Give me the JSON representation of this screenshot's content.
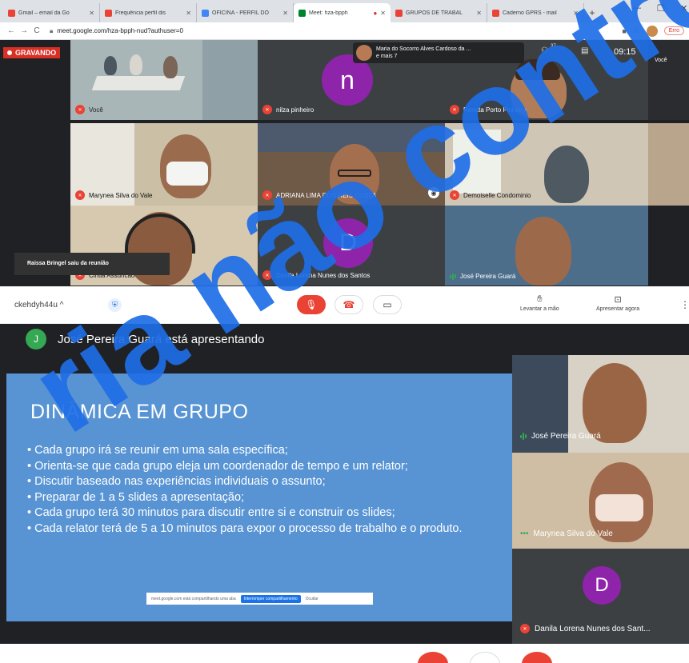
{
  "browser": {
    "tabs": [
      {
        "label": "Gmail – email da Go",
        "color": "#ea4335"
      },
      {
        "label": "Frequência perfil dis",
        "color": "#ea4335"
      },
      {
        "label": "OFICINA - PERFIL DO",
        "color": "#4285f4"
      },
      {
        "label": "Meet: hza-bpph",
        "color": "#00832d",
        "active": true
      },
      {
        "label": "GRUPOS DE TRABAL",
        "color": "#ea4335"
      },
      {
        "label": "Caderno GPRS - mail",
        "color": "#ea4335"
      }
    ],
    "url": "meet.google.com/hza-bpph-nud?authuser=0",
    "error_label": "Erro"
  },
  "meet": {
    "recording_label": "GRAVANDO",
    "notification": {
      "name": "Maria do Socorro Alves Cardoso da ...",
      "more": "e mais 7"
    },
    "participant_count": "37",
    "time": "09:15",
    "self_label": "Você",
    "toast": "Raissa Bringel saiu da reunião",
    "tiles": [
      {
        "name": "Você"
      },
      {
        "name": "nilza pinheiro",
        "letter": "n",
        "color": "#8e24aa"
      },
      {
        "name": "Renata Porto Pinheiro"
      },
      {
        "name": "Marynea Silva do Vale"
      },
      {
        "name": "ADRIANA LIMA DOS REIS COSTA"
      },
      {
        "name": "Demoiselle Condominio"
      },
      {
        "name": "Cintia Assuncao"
      },
      {
        "name": "Danila Lorena Nunes dos Santos",
        "letter": "D",
        "color": "#8e24aa"
      },
      {
        "name": "José Pereira Guará"
      }
    ]
  },
  "controls": {
    "meeting_code": "ckehdyh44u",
    "raise_hand": "Levantar a mão",
    "present_now": "Apresentar agora"
  },
  "presentation": {
    "presenter_initial": "J",
    "presenter_text": "José Pereira Guará está apresentando",
    "slide": {
      "title": "DINÂMICA EM GRUPO",
      "bullets": [
        "Cada grupo irá se reunir em uma sala específica;",
        "Orienta-se que cada grupo eleja um coordenador de tempo e um relator;",
        "Discutir baseado nas experiências individuais o assunto;",
        "Preparar de 1 a 5 slides a apresentação;",
        "Cada grupo terá 30 minutos para discutir entre si e construir os slides;",
        "Cada relator terá de 5 a 10 minutos para expor o processo de trabalho e o produto."
      ]
    },
    "share_bar": {
      "text": "meet.google.com está compartilhando uma aba",
      "stop": "Interromper compartilhamento",
      "hide": "Ocultar"
    },
    "side_tiles": [
      {
        "name": "José Pereira Guará"
      },
      {
        "name": "Marynea Silva do Vale"
      },
      {
        "name": "Danila Lorena Nunes dos Sant...",
        "letter": "D",
        "color": "#8e24aa"
      }
    ]
  },
  "watermark": "ria não controla"
}
